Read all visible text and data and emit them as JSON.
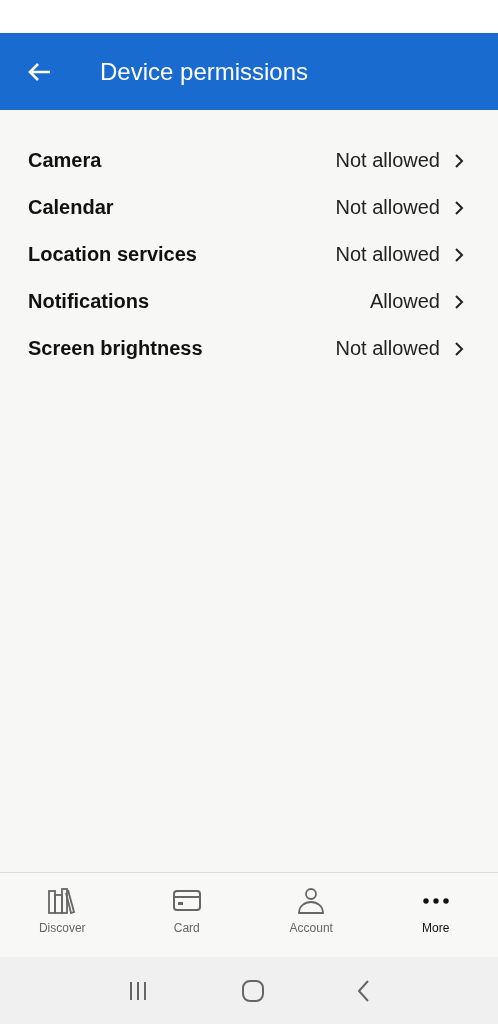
{
  "header": {
    "title": "Device permissions"
  },
  "permissions": [
    {
      "name": "Camera",
      "value": "Not allowed"
    },
    {
      "name": "Calendar",
      "value": "Not allowed"
    },
    {
      "name": "Location services",
      "value": "Not allowed"
    },
    {
      "name": "Notifications",
      "value": "Allowed"
    },
    {
      "name": "Screen brightness",
      "value": "Not allowed"
    }
  ],
  "bottom_nav": [
    {
      "kind": "books",
      "label": "Discover",
      "selected": false
    },
    {
      "kind": "card",
      "label": "Card",
      "selected": false
    },
    {
      "kind": "person",
      "label": "Account",
      "selected": false
    },
    {
      "kind": "dots",
      "label": "More",
      "selected": true
    }
  ]
}
